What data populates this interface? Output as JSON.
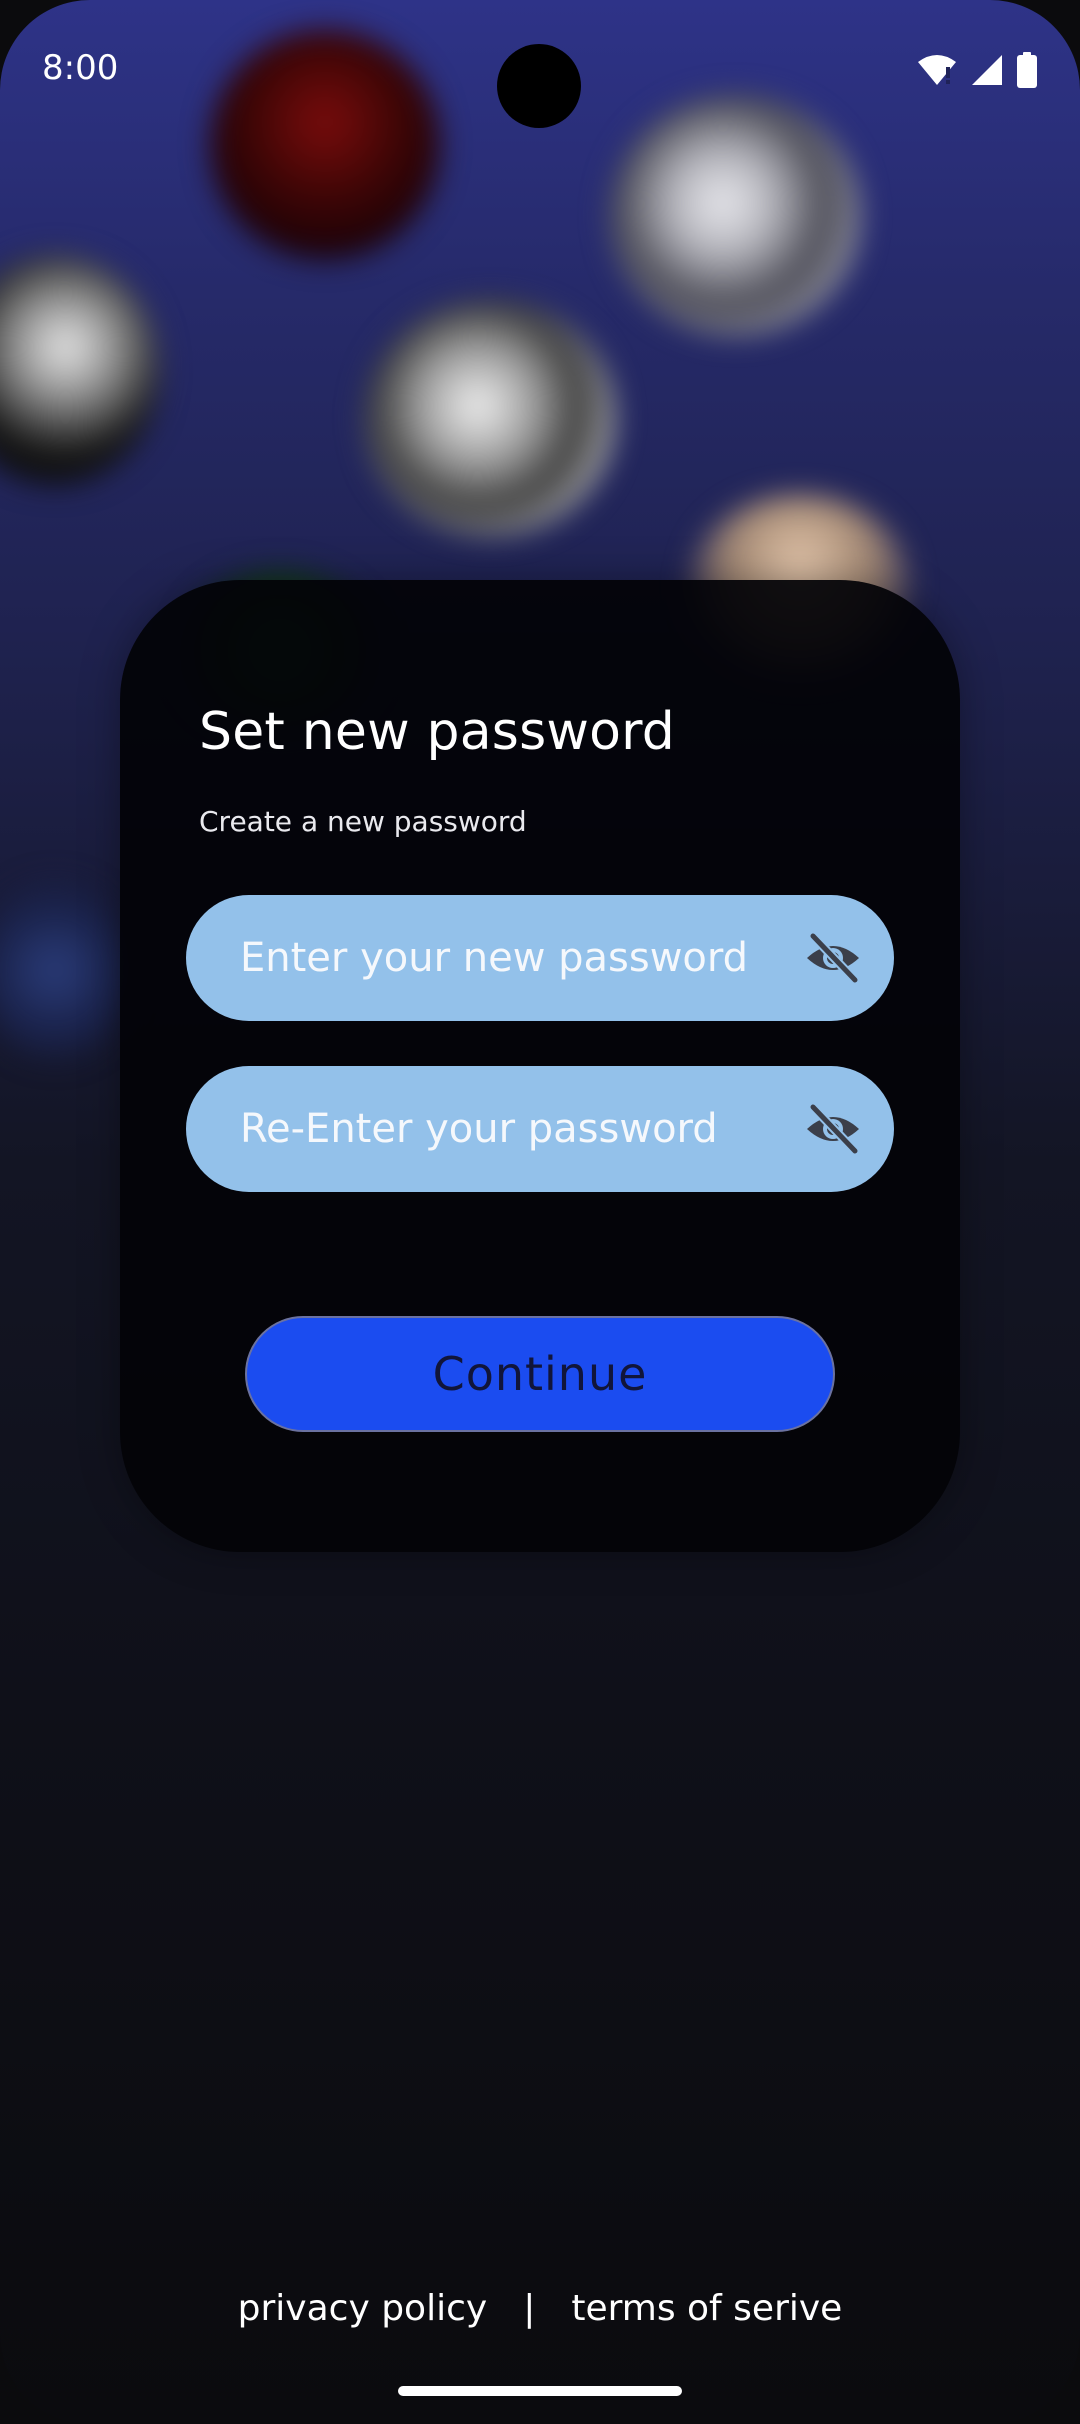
{
  "status_bar": {
    "time": "8:00",
    "icons": [
      "wifi-alert-icon",
      "signal-icon",
      "battery-icon"
    ]
  },
  "card": {
    "title": "Set new password",
    "subtitle": "Create a new password",
    "new_password_placeholder": "Enter your new password",
    "reenter_password_placeholder": "Re-Enter your password",
    "toggle_icon": "eye-off-icon",
    "continue_label": "Continue"
  },
  "footer": {
    "privacy_label": "privacy policy",
    "separator": "|",
    "terms_label": "terms of serive"
  },
  "colors": {
    "field_background": "#93c1ea",
    "button_background": "#1b4cf0",
    "card_background": "#030307"
  }
}
